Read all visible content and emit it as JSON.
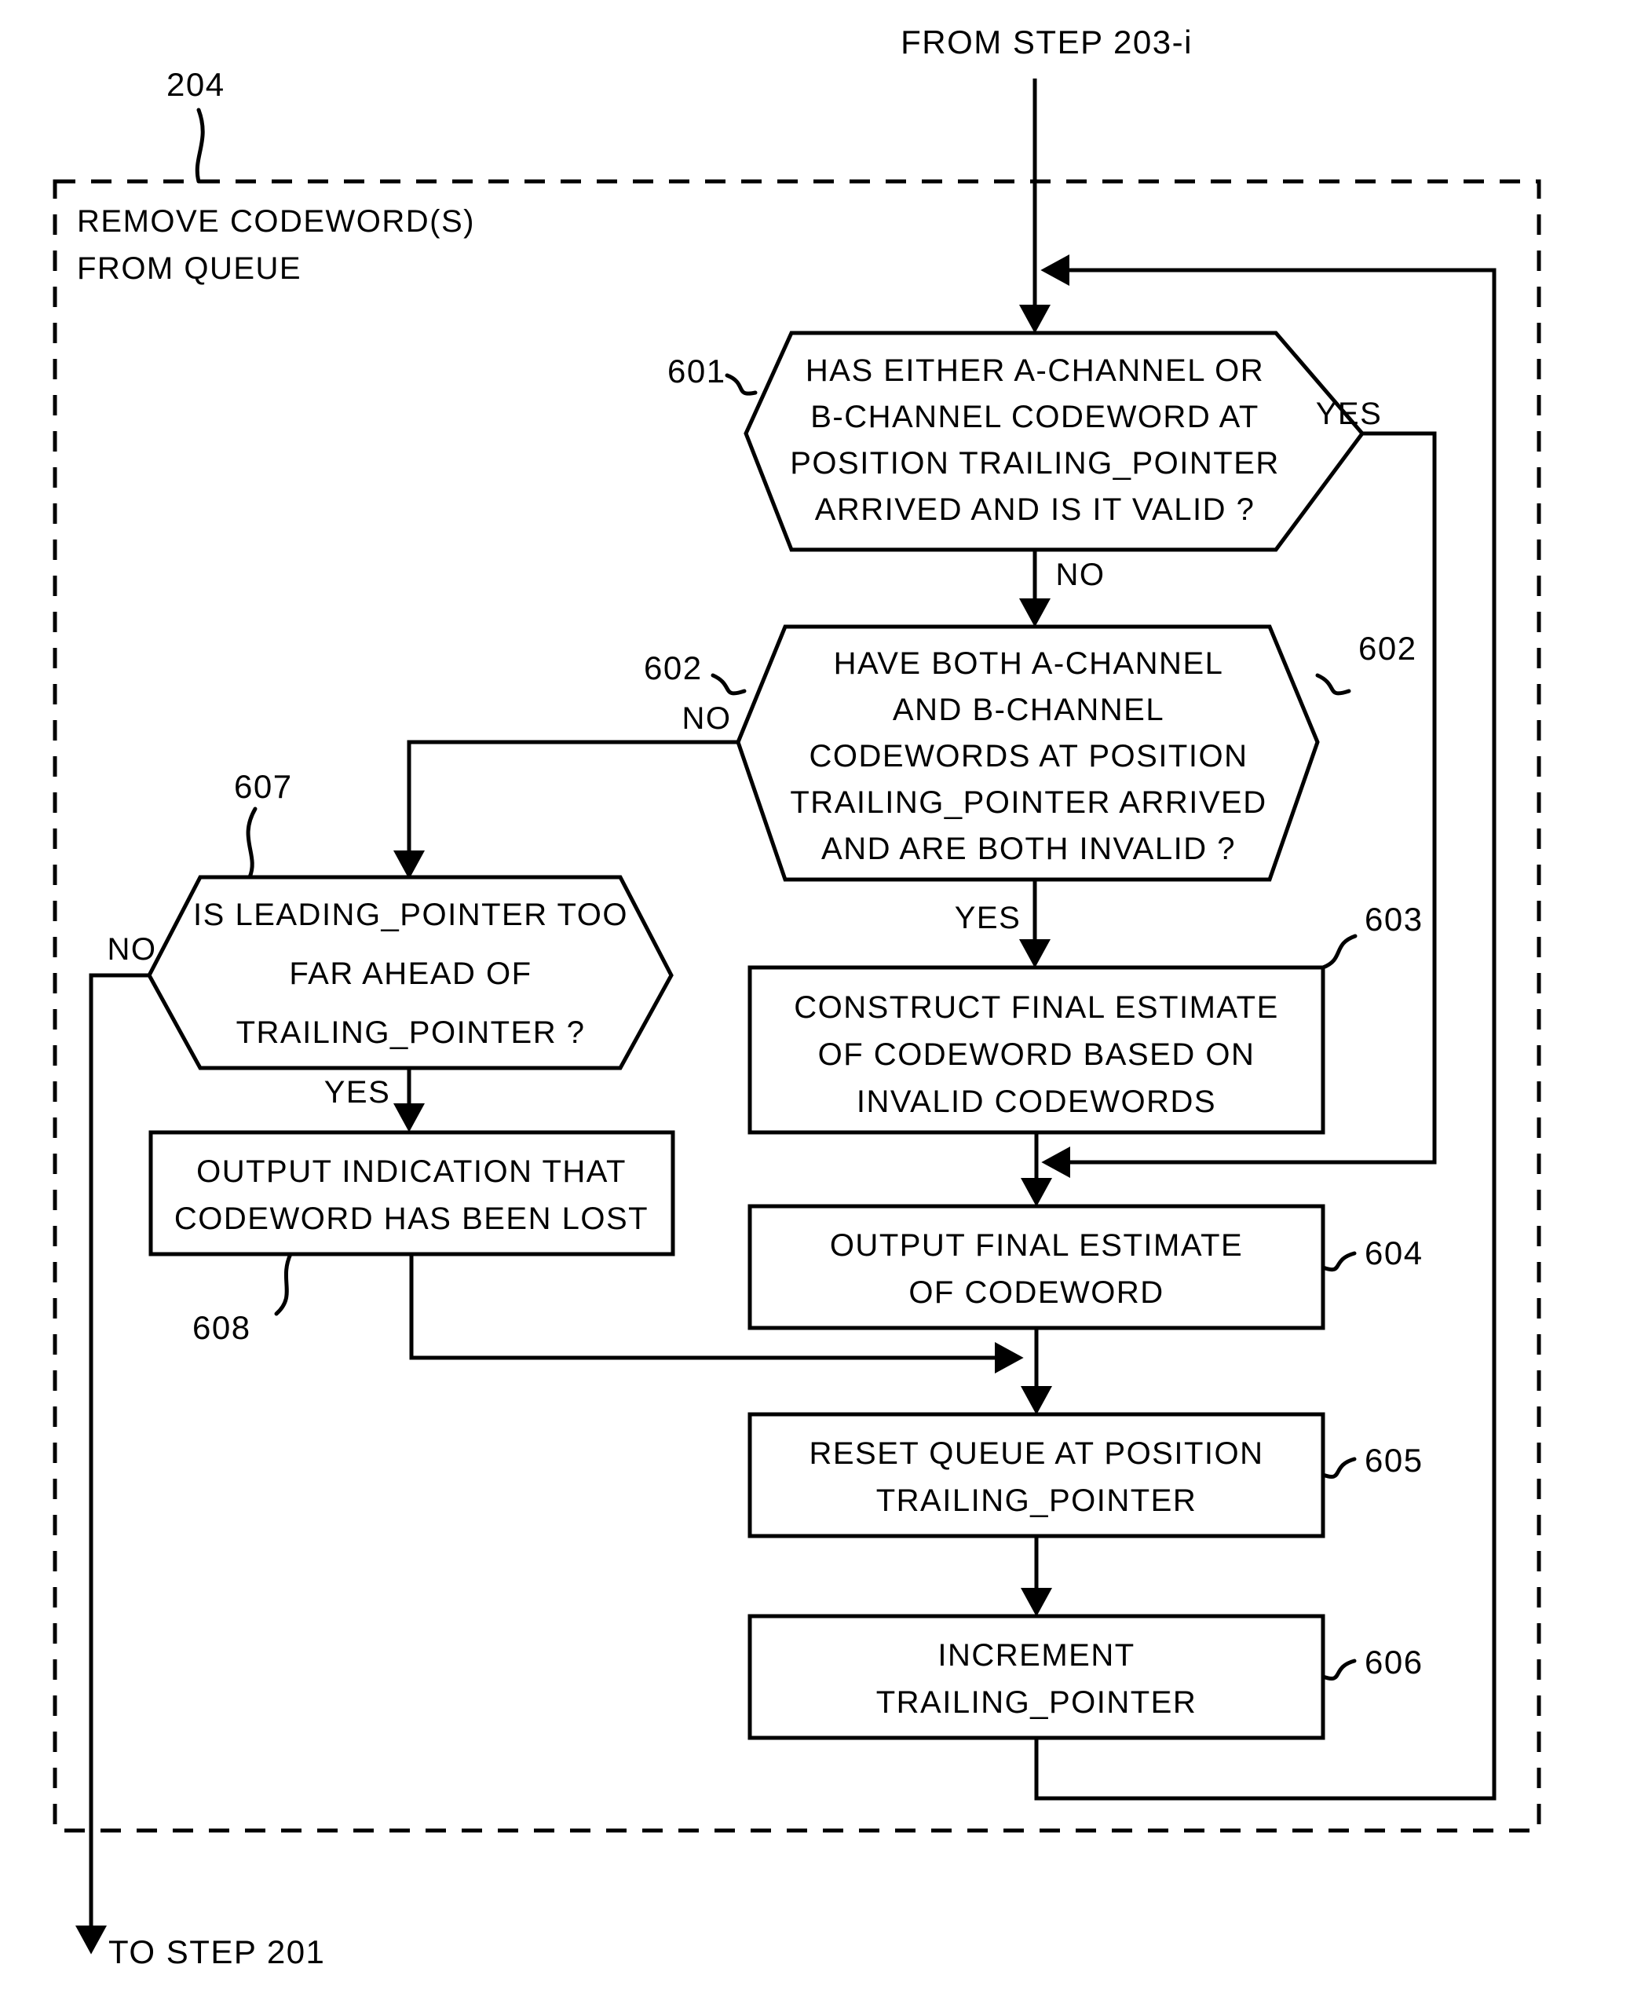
{
  "figure": {
    "entry_label": "FROM STEP 203-i",
    "exit_label": "TO STEP 201",
    "group": {
      "ref": "204",
      "title_line1": "REMOVE CODEWORD(S)",
      "title_line2": "FROM QUEUE"
    },
    "nodes": [
      {
        "id": "n601",
        "ref": "601",
        "shape": "hexagon",
        "lines": [
          "HAS EITHER A-CHANNEL OR",
          "B-CHANNEL CODEWORD AT",
          "POSITION TRAILING_POINTER",
          "ARRIVED AND IS IT VALID ?"
        ]
      },
      {
        "id": "n602",
        "ref": "602",
        "ref_right": "602",
        "shape": "hexagon",
        "lines": [
          "HAVE BOTH A-CHANNEL",
          "AND B-CHANNEL",
          "CODEWORDS AT POSITION",
          "TRAILING_POINTER ARRIVED",
          "AND ARE BOTH INVALID ?"
        ]
      },
      {
        "id": "n607",
        "ref": "607",
        "shape": "hexagon",
        "lines": [
          "IS LEADING_POINTER TOO",
          "FAR AHEAD OF",
          "TRAILING_POINTER ?"
        ]
      },
      {
        "id": "n603",
        "ref": "603",
        "shape": "rect",
        "lines": [
          "CONSTRUCT FINAL ESTIMATE",
          "OF CODEWORD BASED ON",
          "INVALID CODEWORDS"
        ]
      },
      {
        "id": "n608",
        "ref": "608",
        "shape": "rect",
        "lines": [
          "OUTPUT INDICATION THAT",
          "CODEWORD HAS BEEN LOST"
        ]
      },
      {
        "id": "n604",
        "ref": "604",
        "shape": "rect",
        "lines": [
          "OUTPUT FINAL ESTIMATE",
          "OF CODEWORD"
        ]
      },
      {
        "id": "n605",
        "ref": "605",
        "shape": "rect",
        "lines": [
          "RESET QUEUE AT POSITION",
          "TRAILING_POINTER"
        ]
      },
      {
        "id": "n606",
        "ref": "606",
        "shape": "rect",
        "lines": [
          "INCREMENT",
          "TRAILING_POINTER"
        ]
      }
    ],
    "branch_labels": {
      "n601_yes": "YES",
      "n601_no": "NO",
      "n602_no": "NO",
      "n602_yes": "YES",
      "n607_no": "NO",
      "n607_yes": "YES"
    },
    "colors": {
      "ink": "#000000",
      "paper": "#ffffff"
    }
  }
}
